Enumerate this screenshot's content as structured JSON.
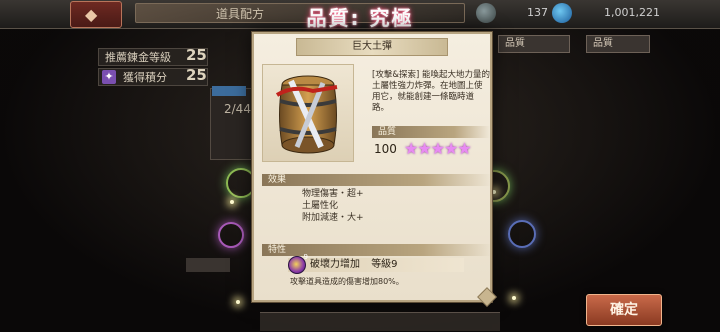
{
  "header": {
    "screen_title": "道具配方",
    "quality_title": "品質: 究極",
    "resource_a_value": "137",
    "resource_b_value": "1,001,221"
  },
  "left_panel": {
    "recommended_level_label": "推薦錬金等級",
    "recommended_level_value": "25",
    "points_label": "獲得積分",
    "points_value": "25",
    "card_count": "2/44"
  },
  "right_panel": {
    "button_a": "品質",
    "button_b": "品質"
  },
  "item": {
    "name": "巨大土彈",
    "description": "[攻擊&探索] 能喚起大地力量的土屬性強力炸彈。在地圖上使用它，就能創建一條臨時道路。",
    "quality_label": "品質",
    "quality_value": "100",
    "stars": "★★★★★",
    "effects_label": "效果",
    "effects": [
      "物理傷害・超+",
      "土屬性化",
      "附加減速・大+"
    ],
    "traits_label": "特性",
    "trait_name": "破壞力增加",
    "trait_level": "等級9",
    "trait_badge": "9",
    "trait_description": "攻擊道具造成的傷害增加80%。"
  },
  "footer": {
    "confirm_label": "確定"
  },
  "icons": {
    "back": "back-arrow-icon",
    "resource_a": "gem-icon",
    "resource_b": "orb-icon",
    "trait": "trait-orb-icon"
  },
  "colors": {
    "quality_glow": "#ff3c6e",
    "stars": "#e88bf2",
    "confirm": "#c96a4a"
  }
}
